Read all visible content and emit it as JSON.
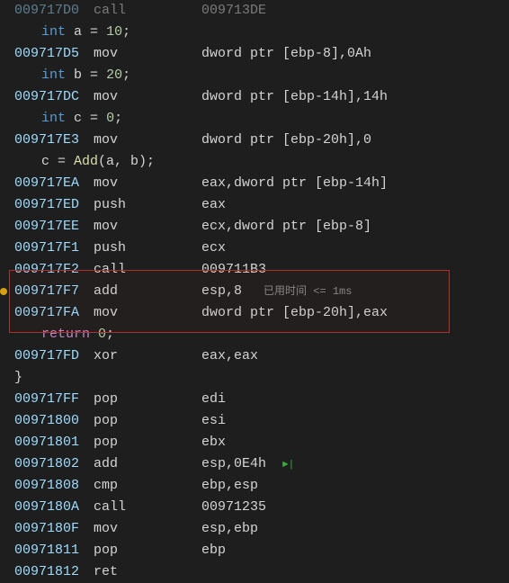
{
  "lines": [
    {
      "type": "asm_cut",
      "addr": "009717D0",
      "mnem": "call",
      "oper": "009713DE"
    },
    {
      "type": "src",
      "tokens": [
        {
          "cls": "kw-type",
          "t": "int"
        },
        {
          "cls": "punct",
          "t": " "
        },
        {
          "cls": "ident",
          "t": "a"
        },
        {
          "cls": "punct",
          "t": " = "
        },
        {
          "cls": "num",
          "t": "10"
        },
        {
          "cls": "punct",
          "t": ";"
        }
      ]
    },
    {
      "type": "asm",
      "addr": "009717D5",
      "mnem": "mov",
      "oper": "dword ptr [ebp-8],0Ah"
    },
    {
      "type": "src",
      "tokens": [
        {
          "cls": "kw-type",
          "t": "int"
        },
        {
          "cls": "punct",
          "t": " "
        },
        {
          "cls": "ident",
          "t": "b"
        },
        {
          "cls": "punct",
          "t": " = "
        },
        {
          "cls": "num",
          "t": "20"
        },
        {
          "cls": "punct",
          "t": ";"
        }
      ]
    },
    {
      "type": "asm",
      "addr": "009717DC",
      "mnem": "mov",
      "oper": "dword ptr [ebp-14h],14h"
    },
    {
      "type": "src",
      "tokens": [
        {
          "cls": "kw-type",
          "t": "int"
        },
        {
          "cls": "punct",
          "t": " "
        },
        {
          "cls": "ident",
          "t": "c"
        },
        {
          "cls": "punct",
          "t": " = "
        },
        {
          "cls": "num",
          "t": "0"
        },
        {
          "cls": "punct",
          "t": ";"
        }
      ]
    },
    {
      "type": "asm",
      "addr": "009717E3",
      "mnem": "mov",
      "oper": "dword ptr [ebp-20h],0"
    },
    {
      "type": "src",
      "tokens": [
        {
          "cls": "ident",
          "t": "c"
        },
        {
          "cls": "punct",
          "t": " = "
        },
        {
          "cls": "func",
          "t": "Add"
        },
        {
          "cls": "punct",
          "t": "(a, b);"
        }
      ]
    },
    {
      "type": "asm",
      "addr": "009717EA",
      "mnem": "mov",
      "oper": "eax,dword ptr [ebp-14h]"
    },
    {
      "type": "asm",
      "addr": "009717ED",
      "mnem": "push",
      "oper": "eax"
    },
    {
      "type": "asm",
      "addr": "009717EE",
      "mnem": "mov",
      "oper": "ecx,dword ptr [ebp-8]"
    },
    {
      "type": "asm",
      "addr": "009717F1",
      "mnem": "push",
      "oper": "ecx"
    },
    {
      "type": "asm",
      "addr": "009717F2",
      "mnem": "call",
      "oper": "009711B3"
    },
    {
      "type": "asm",
      "addr": "009717F7",
      "mnem": "add",
      "oper": "esp,8",
      "timing": "已用时间 <= 1ms",
      "bp": true
    },
    {
      "type": "asm",
      "addr": "009717FA",
      "mnem": "mov",
      "oper": "dword ptr [ebp-20h],eax"
    },
    {
      "type": "src",
      "tokens": [
        {
          "cls": "kw-ret",
          "t": "return"
        },
        {
          "cls": "punct",
          "t": " "
        },
        {
          "cls": "num",
          "t": "0"
        },
        {
          "cls": "punct",
          "t": ";"
        }
      ]
    },
    {
      "type": "asm",
      "addr": "009717FD",
      "mnem": "xor",
      "oper": "eax,eax"
    },
    {
      "type": "brace",
      "t": "}"
    },
    {
      "type": "asm",
      "addr": "009717FF",
      "mnem": "pop",
      "oper": "edi"
    },
    {
      "type": "asm",
      "addr": "00971800",
      "mnem": "pop",
      "oper": "esi"
    },
    {
      "type": "asm",
      "addr": "00971801",
      "mnem": "pop",
      "oper": "ebx"
    },
    {
      "type": "asm",
      "addr": "00971802",
      "mnem": "add",
      "oper": "esp,0E4h",
      "step": "►|"
    },
    {
      "type": "asm",
      "addr": "00971808",
      "mnem": "cmp",
      "oper": "ebp,esp"
    },
    {
      "type": "asm",
      "addr": "0097180A",
      "mnem": "call",
      "oper": "00971235"
    },
    {
      "type": "asm",
      "addr": "0097180F",
      "mnem": "mov",
      "oper": "esp,ebp"
    },
    {
      "type": "asm",
      "addr": "00971811",
      "mnem": "pop",
      "oper": "ebp"
    },
    {
      "type": "asm",
      "addr": "00971812",
      "mnem": "ret",
      "oper": ""
    }
  ]
}
